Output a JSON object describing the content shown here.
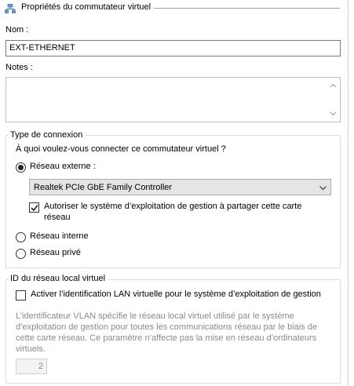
{
  "section": {
    "title": "Propriétés du commutateur virtuel",
    "icon": "network-switch-icon"
  },
  "name_field": {
    "label": "Nom :",
    "value": "EXT-ETHERNET"
  },
  "notes_field": {
    "label": "Notes :",
    "value": ""
  },
  "connection_type": {
    "group_title": "Type de connexion",
    "question": "À quoi voulez-vous connecter ce commutateur virtuel ?",
    "external": {
      "label": "Réseau externe :",
      "selected": true,
      "adapter": "Realtek PCIe GbE Family Controller",
      "share_checkbox": {
        "line1": "Autoriser le système d’exploitation de gestion à partager cette carte",
        "line2": "réseau",
        "checked": true
      }
    },
    "internal": {
      "label": "Réseau interne",
      "selected": false
    },
    "private": {
      "label": "Réseau privé",
      "selected": false
    }
  },
  "vlan": {
    "group_title": "ID du réseau local virtuel",
    "checkbox": {
      "label": "Activer l’identification LAN virtuelle pour le système d’exploitation de gestion",
      "checked": false
    },
    "description": [
      "L’identificateur VLAN spécifie le réseau local virtuel utilisé par le système",
      "d’exploitation de gestion pour toutes les communications réseau par le biais de",
      "cette carte réseau. Ce paramètre n’affecte pas la mise en réseau d’ordinateurs",
      "virtuels."
    ],
    "id_value": "2"
  }
}
